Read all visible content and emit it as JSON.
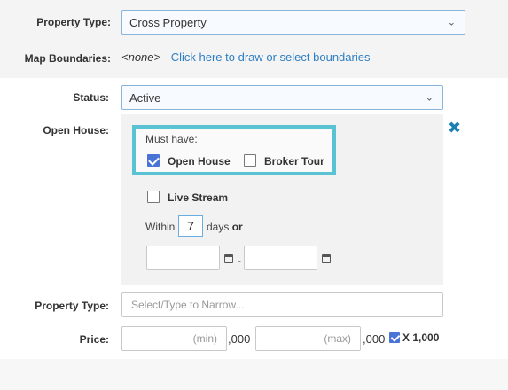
{
  "filters": {
    "property_type_top": {
      "label": "Property Type:",
      "value": "Cross Property"
    },
    "map_boundaries": {
      "label": "Map Boundaries:",
      "value": "<none>",
      "link": "Click here to draw or select boundaries"
    },
    "status": {
      "label": "Status:",
      "value": "Active"
    },
    "open_house": {
      "label": "Open House:",
      "must_have": "Must have:",
      "open_house_checkbox": {
        "label": "Open House",
        "checked": true
      },
      "broker_tour_checkbox": {
        "label": "Broker Tour",
        "checked": false
      },
      "live_stream_checkbox": {
        "label": "Live Stream",
        "checked": false
      },
      "within_label": "Within",
      "days_value": "7",
      "days_label": "days",
      "or_label": "or",
      "date_separator": "-"
    },
    "property_type_bottom": {
      "label": "Property Type:",
      "placeholder": "Select/Type to Narrow..."
    },
    "price": {
      "label": "Price:",
      "min_placeholder": "(min)",
      "max_placeholder": "(max)",
      "thousands_suffix": ",000",
      "x1000_checkbox": {
        "label": "X 1,000",
        "checked": true
      }
    }
  },
  "icons": {
    "chevron": "chevron-down-icon",
    "close": "close-icon",
    "calendar": "calendar-icon"
  },
  "colors": {
    "accent": "#2e7ec4",
    "highlight_border": "#59c3d4",
    "checkbox_checked": "#4a73d6",
    "close_icon": "#1b7eb5"
  }
}
